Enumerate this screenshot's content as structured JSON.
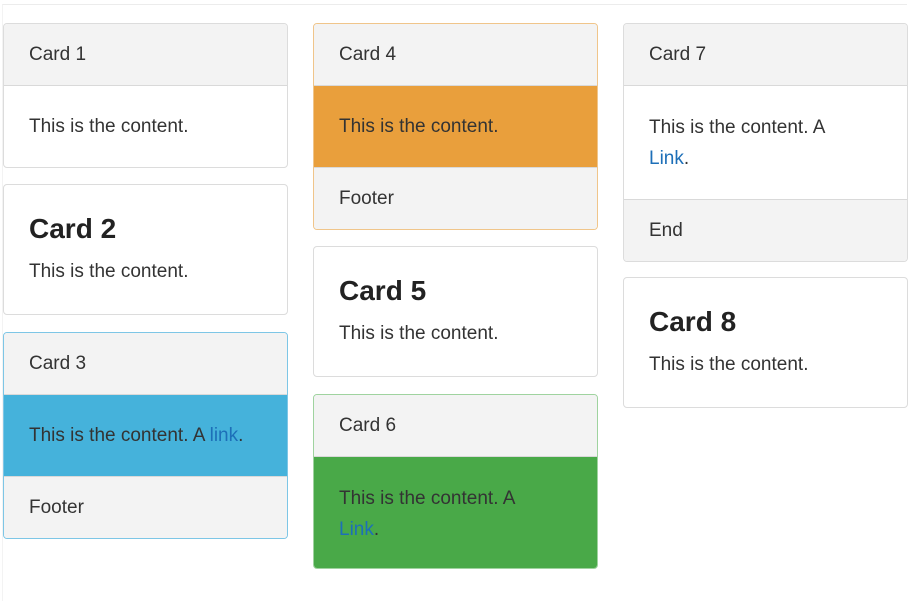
{
  "cards": {
    "card1": {
      "header": "Card 1",
      "content": "This is the content."
    },
    "card2": {
      "title": "Card 2",
      "content": "This is the content."
    },
    "card3": {
      "header": "Card 3",
      "content": "This is the content. A ",
      "link": "link",
      "after_link": ".",
      "footer": "Footer"
    },
    "card4": {
      "header": "Card 4",
      "content": "This is the content.",
      "footer": "Footer"
    },
    "card5": {
      "title": "Card 5",
      "content": "This is the content."
    },
    "card6": {
      "header": "Card 6",
      "content": "This is the content. A",
      "link": "Link",
      "after_link": "."
    },
    "card7": {
      "header": "Card 7",
      "content": "This is the content. A",
      "link": "Link",
      "after_link": ".",
      "footer": "End"
    },
    "card8": {
      "title": "Card 8",
      "content": "This is the content."
    }
  },
  "colors": {
    "info": "#45b2db",
    "warning": "#e99f3c",
    "success": "#49a948",
    "link": "#1d6fb8",
    "header_bg": "#f3f3f3"
  }
}
